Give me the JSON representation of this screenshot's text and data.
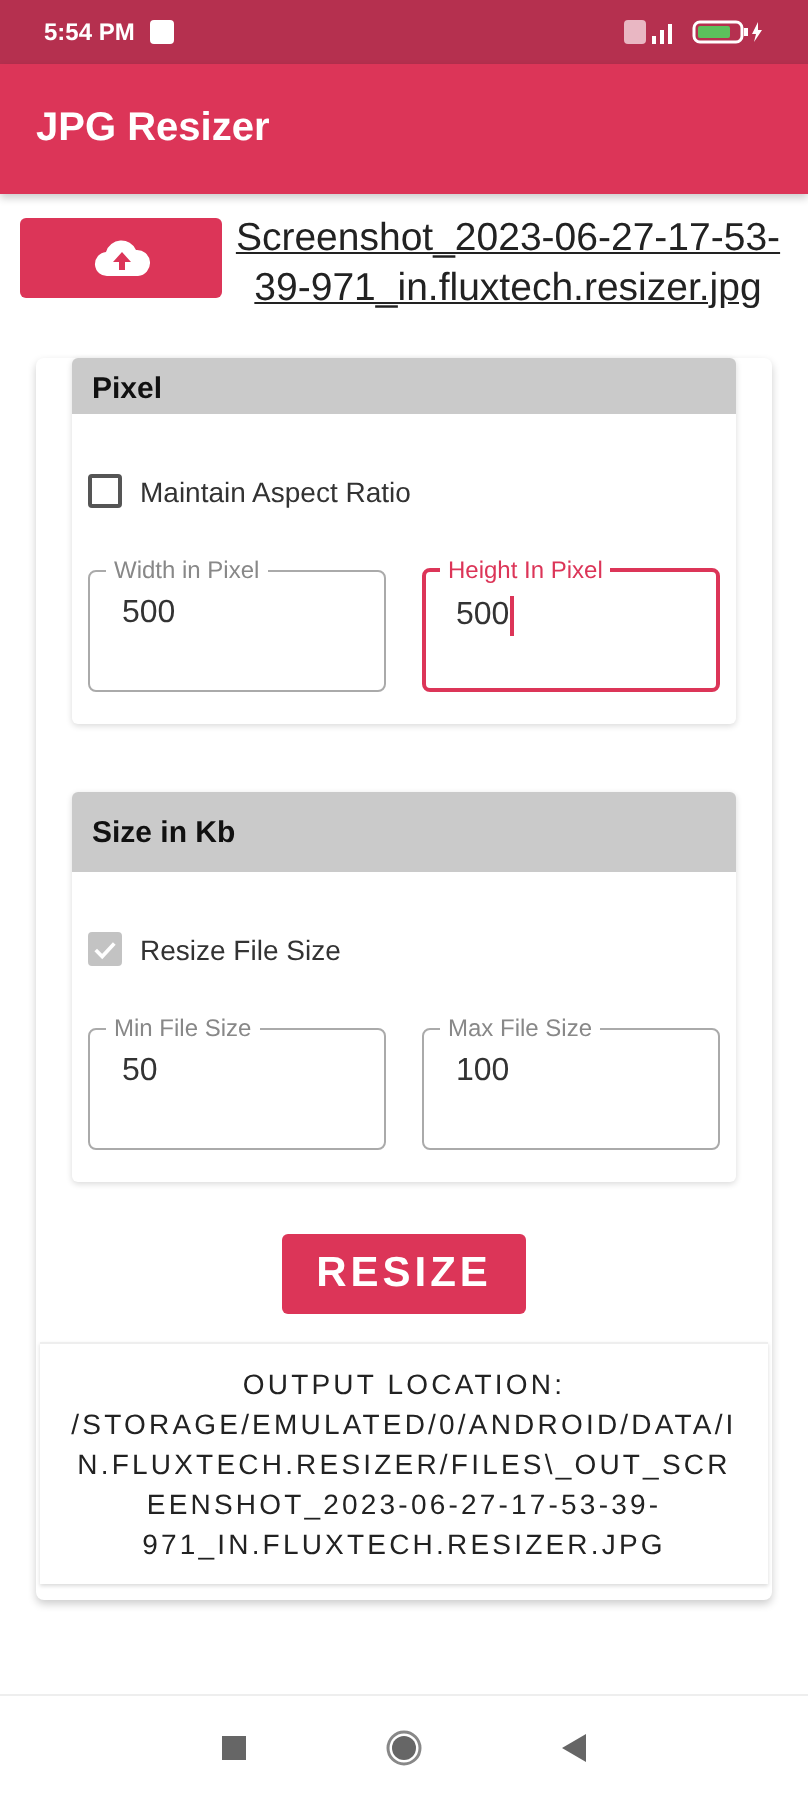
{
  "status_bar": {
    "time": "5:54 PM"
  },
  "app_bar": {
    "title": "JPG Resizer"
  },
  "upload": {
    "file_name": "Screenshot_2023-06-27-17-53-39-971_in.fluxtech.resizer.jpg"
  },
  "sections": [
    {
      "title": "Pixel",
      "checkbox": {
        "label": "Maintain Aspect Ratio",
        "checked": false,
        "disabled": false
      },
      "fields": [
        {
          "label": "Width in Pixel",
          "value": "500",
          "focused": false
        },
        {
          "label": "Height In Pixel",
          "value": "500",
          "focused": true
        }
      ]
    },
    {
      "title": "Size in Kb",
      "checkbox": {
        "label": "Resize File Size",
        "checked": true,
        "disabled": true
      },
      "fields": [
        {
          "label": "Min File Size",
          "value": "50",
          "focused": false
        },
        {
          "label": "Max File Size",
          "value": "100",
          "focused": false
        }
      ]
    }
  ],
  "resize_button": "RESIZE",
  "output": "OUTPUT LOCATION: /STORAGE/EMULATED/0/ANDROID/DATA/IN.FLUXTECH.RESIZER/FILES\\_OUT_SCREENSHOT_2023-06-27-17-53-39-971_IN.FLUXTECH.RESIZER.JPG"
}
